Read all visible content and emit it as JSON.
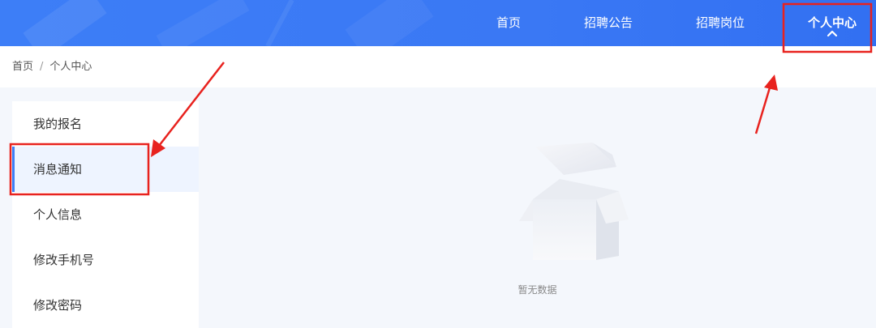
{
  "header": {
    "nav": [
      {
        "label": "首页"
      },
      {
        "label": "招聘公告"
      },
      {
        "label": "招聘岗位"
      },
      {
        "label": "个人中心"
      }
    ]
  },
  "breadcrumb": {
    "home": "首页",
    "separator": "/",
    "current": "个人中心"
  },
  "sidebar": {
    "items": [
      {
        "label": "我的报名"
      },
      {
        "label": "消息通知",
        "active": true
      },
      {
        "label": "个人信息"
      },
      {
        "label": "修改手机号"
      },
      {
        "label": "修改密码"
      }
    ]
  },
  "main": {
    "empty_text": "暂无数据"
  },
  "colors": {
    "brand": "#3d7ef7",
    "annotation": "#e8221e",
    "active_bg": "#eef4ff"
  }
}
